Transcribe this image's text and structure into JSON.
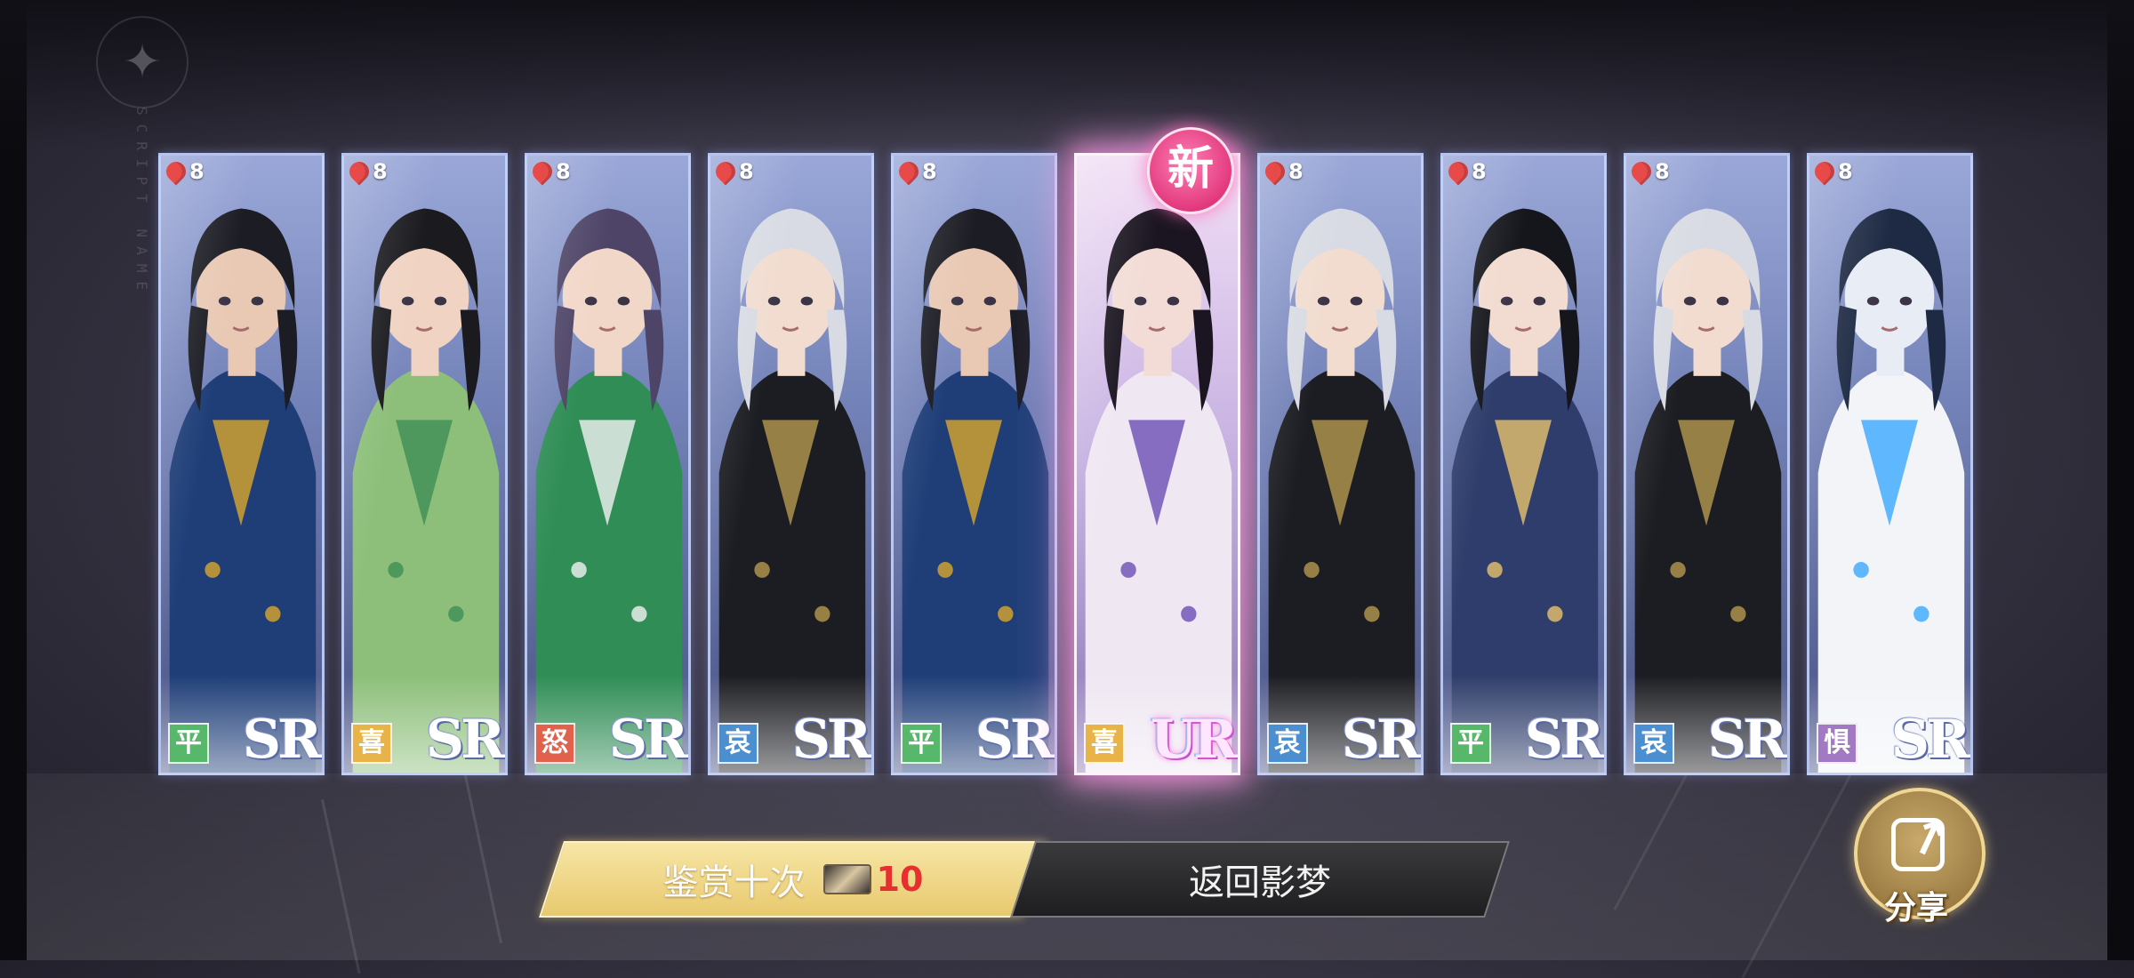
{
  "watermark": {
    "side_text": "SCRIPT NAME"
  },
  "cards": [
    {
      "level": "8",
      "mood": "平",
      "mood_color": "#57b76a",
      "rarity": "SR",
      "hair": "#1c1c24",
      "skin": "#e9c9b4",
      "outfit": "#1f3e78",
      "accent": "#d9a62c"
    },
    {
      "level": "8",
      "mood": "喜",
      "mood_color": "#e8b44a",
      "rarity": "SR",
      "hair": "#1a1a1f",
      "skin": "#f0d3c3",
      "outfit": "#8dbf7a",
      "accent": "#3e8f58"
    },
    {
      "level": "8",
      "mood": "怒",
      "mood_color": "#e0614c",
      "rarity": "SR",
      "hair": "#4e4467",
      "skin": "#f1d7c8",
      "outfit": "#2f8d55",
      "accent": "#f3f3f3"
    },
    {
      "level": "8",
      "mood": "哀",
      "mood_color": "#4c8fd1",
      "rarity": "SR",
      "hair": "#d8dbe3",
      "skin": "#f2dcd0",
      "outfit": "#1c1d22",
      "accent": "#b69a50"
    },
    {
      "level": "8",
      "mood": "平",
      "mood_color": "#57b76a",
      "rarity": "SR",
      "hair": "#1c1c24",
      "skin": "#e9c9b4",
      "outfit": "#1f3e78",
      "accent": "#d9a62c"
    },
    {
      "level": "",
      "mood": "喜",
      "mood_color": "#e8b44a",
      "rarity": "UR",
      "hair": "#1a1520",
      "skin": "#f3dcd6",
      "outfit": "#efe7f2",
      "accent": "#6b4fb5"
    },
    {
      "level": "8",
      "mood": "哀",
      "mood_color": "#4c8fd1",
      "rarity": "SR",
      "hair": "#d8dbe3",
      "skin": "#f2dcd0",
      "outfit": "#1c1d22",
      "accent": "#b69a50"
    },
    {
      "level": "8",
      "mood": "平",
      "mood_color": "#57b76a",
      "rarity": "SR",
      "hair": "#15161c",
      "skin": "#f2dbd0",
      "outfit": "#2e3d6b",
      "accent": "#e7c36e"
    },
    {
      "level": "8",
      "mood": "哀",
      "mood_color": "#4c8fd1",
      "rarity": "SR",
      "hair": "#d8dbe3",
      "skin": "#f2dcd0",
      "outfit": "#1c1d22",
      "accent": "#b69a50"
    },
    {
      "level": "8",
      "mood": "惧",
      "mood_color": "#a27ac4",
      "rarity": "SR",
      "hair": "#1e2a44",
      "skin": "#e7ecf5",
      "outfit": "#f2f4f8",
      "accent": "#3aa9ff"
    }
  ],
  "new_badge": "新",
  "buttons": {
    "appraise_label": "鉴赏十次",
    "appraise_cost": "10",
    "return_label": "返回影梦",
    "share_label": "分享"
  }
}
